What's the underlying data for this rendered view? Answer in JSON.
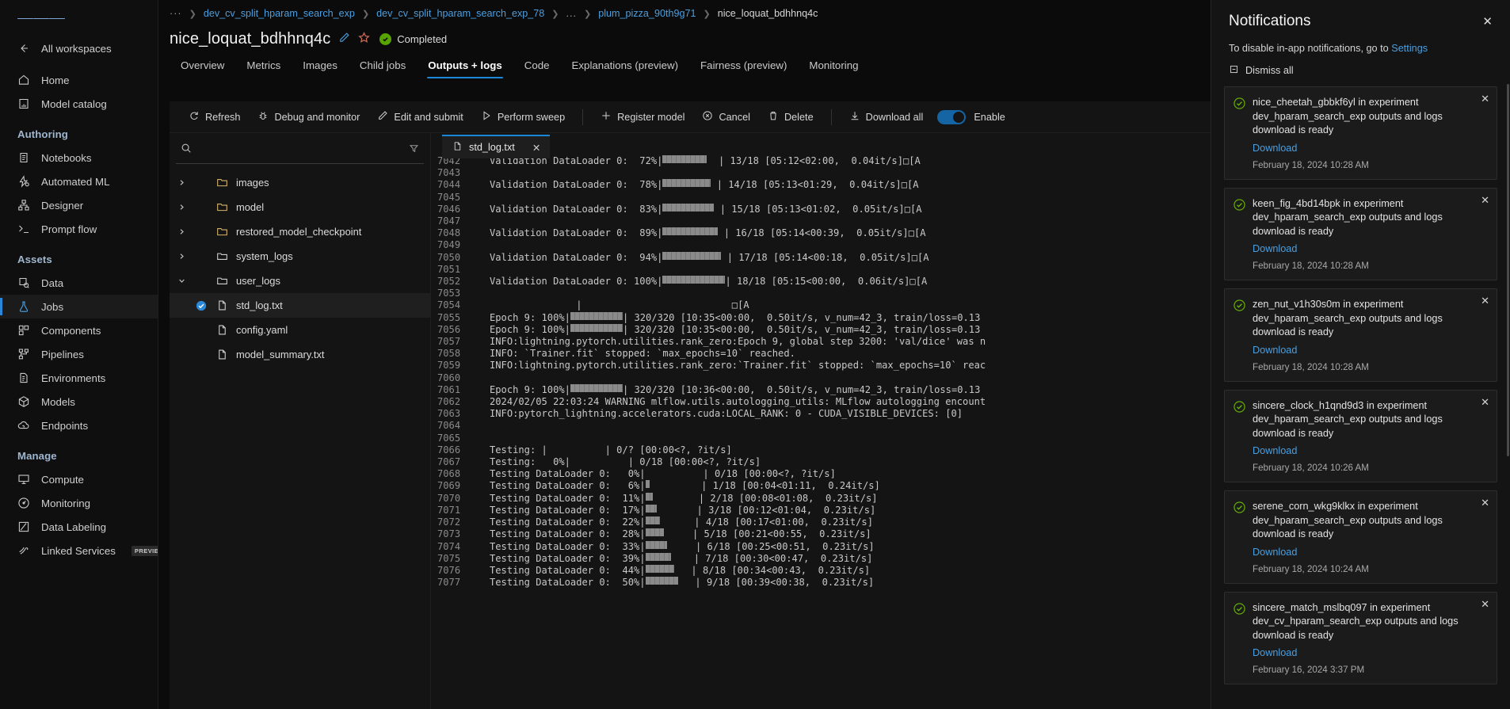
{
  "sidebar": {
    "menu_icon": "hamburger-icon",
    "back_label": "All workspaces",
    "top_items": [
      {
        "label": "Home",
        "icon": "home-icon"
      },
      {
        "label": "Model catalog",
        "icon": "model-catalog-icon"
      }
    ],
    "sections": [
      {
        "title": "Authoring",
        "items": [
          {
            "label": "Notebooks",
            "icon": "notebook-icon"
          },
          {
            "label": "Automated ML",
            "icon": "automated-ml-icon"
          },
          {
            "label": "Designer",
            "icon": "designer-icon"
          },
          {
            "label": "Prompt flow",
            "icon": "terminal-icon"
          }
        ]
      },
      {
        "title": "Assets",
        "items": [
          {
            "label": "Data",
            "icon": "data-icon"
          },
          {
            "label": "Jobs",
            "icon": "flask-icon",
            "active": true
          },
          {
            "label": "Components",
            "icon": "components-icon"
          },
          {
            "label": "Pipelines",
            "icon": "pipelines-icon"
          },
          {
            "label": "Environments",
            "icon": "environments-icon"
          },
          {
            "label": "Models",
            "icon": "cube-icon"
          },
          {
            "label": "Endpoints",
            "icon": "endpoints-icon"
          }
        ]
      },
      {
        "title": "Manage",
        "items": [
          {
            "label": "Compute",
            "icon": "compute-icon"
          },
          {
            "label": "Monitoring",
            "icon": "monitoring-icon"
          },
          {
            "label": "Data Labeling",
            "icon": "data-labeling-icon"
          },
          {
            "label": "Linked Services",
            "icon": "linked-services-icon",
            "badge": "PREVIEW"
          }
        ]
      }
    ]
  },
  "breadcrumb": {
    "overflow": "···",
    "items": [
      {
        "label": "dev_cv_split_hparam_search_exp",
        "link": true
      },
      {
        "label": "dev_cv_split_hparam_search_exp_78",
        "link": true
      },
      {
        "label": "...",
        "link": true,
        "ellipsis": true
      },
      {
        "label": "plum_pizza_90th9g71",
        "link": true
      },
      {
        "label": "nice_loquat_bdhhnq4c",
        "link": false
      }
    ]
  },
  "header": {
    "title": "nice_loquat_bdhhnq4c",
    "edit_icon": "pencil-icon",
    "favorite_icon": "star-icon",
    "status": "Completed",
    "status_color": "#57a300"
  },
  "tabs": [
    {
      "label": "Overview"
    },
    {
      "label": "Metrics"
    },
    {
      "label": "Images"
    },
    {
      "label": "Child jobs"
    },
    {
      "label": "Outputs + logs",
      "active": true
    },
    {
      "label": "Code"
    },
    {
      "label": "Explanations (preview)"
    },
    {
      "label": "Fairness (preview)"
    },
    {
      "label": "Monitoring"
    }
  ],
  "toolbar": {
    "buttons": [
      {
        "label": "Refresh",
        "icon": "refresh-icon"
      },
      {
        "label": "Debug and monitor",
        "icon": "bug-icon"
      },
      {
        "label": "Edit and submit",
        "icon": "pencil-icon"
      },
      {
        "label": "Perform sweep",
        "icon": "play-icon"
      },
      {
        "label": "Register model",
        "icon": "plus-icon"
      },
      {
        "label": "Cancel",
        "icon": "cancel-icon"
      },
      {
        "label": "Delete",
        "icon": "trash-icon"
      }
    ],
    "download_all": {
      "label": "Download all",
      "icon": "download-icon"
    },
    "toggle_label": "Enable",
    "toggle_on": true,
    "toggle_color": "#1565a5"
  },
  "filetree": {
    "search_placeholder": "",
    "search_value": "",
    "search_icon": "search-icon",
    "filter_icon": "filter-icon",
    "nodes": [
      {
        "label": "images",
        "type": "folder",
        "expandable": true,
        "expanded": false,
        "indent": 0
      },
      {
        "label": "model",
        "type": "folder",
        "expandable": true,
        "expanded": false,
        "indent": 0
      },
      {
        "label": "restored_model_checkpoint",
        "type": "folder",
        "expandable": true,
        "expanded": false,
        "indent": 0
      },
      {
        "label": "system_logs",
        "type": "folder-open",
        "expandable": true,
        "expanded": false,
        "indent": 0
      },
      {
        "label": "user_logs",
        "type": "folder-open",
        "expandable": true,
        "expanded": true,
        "indent": 0
      },
      {
        "label": "std_log.txt",
        "type": "file",
        "expandable": false,
        "indent": 1,
        "selected": true,
        "checked": true
      },
      {
        "label": "config.yaml",
        "type": "file",
        "expandable": false,
        "indent": 0
      },
      {
        "label": "model_summary.txt",
        "type": "file",
        "expandable": false,
        "indent": 0
      }
    ]
  },
  "filetab": {
    "label": "std_log.txt",
    "file_icon": "file-icon",
    "close_icon": "close-icon"
  },
  "log": {
    "lines": [
      {
        "n": "7042",
        "t": "Validation DataLoader 0:  72%|",
        "bar": 56,
        "t2": "  | 13/18 [05:12<02:00,  0.04it/s]□[A"
      },
      {
        "n": "7043",
        "t": ""
      },
      {
        "n": "7044",
        "t": "Validation DataLoader 0:  78%|",
        "bar": 61,
        "t2": " | 14/18 [05:13<01:29,  0.04it/s]□[A"
      },
      {
        "n": "7045",
        "t": ""
      },
      {
        "n": "7046",
        "t": "Validation DataLoader 0:  83%|",
        "bar": 65,
        "t2": " | 15/18 [05:13<01:02,  0.05it/s]□[A"
      },
      {
        "n": "7047",
        "t": ""
      },
      {
        "n": "7048",
        "t": "Validation DataLoader 0:  89%|",
        "bar": 70,
        "t2": " | 16/18 [05:14<00:39,  0.05it/s]□[A"
      },
      {
        "n": "7049",
        "t": ""
      },
      {
        "n": "7050",
        "t": "Validation DataLoader 0:  94%|",
        "bar": 74,
        "t2": " | 17/18 [05:14<00:18,  0.05it/s]□[A"
      },
      {
        "n": "7051",
        "t": ""
      },
      {
        "n": "7052",
        "t": "Validation DataLoader 0: 100%|",
        "bar": 79,
        "t2": "| 18/18 [05:15<00:00,  0.06it/s]□[A"
      },
      {
        "n": "7053",
        "t": ""
      },
      {
        "n": "7054",
        "t": "               |                          □[A"
      },
      {
        "n": "7055",
        "t": "Epoch 9: 100%|",
        "bar": 66,
        "t2": "| 320/320 [10:35<00:00,  0.50it/s, v_num=42_3, train/loss=0.13"
      },
      {
        "n": "7056",
        "t": "Epoch 9: 100%|",
        "bar": 66,
        "t2": "| 320/320 [10:35<00:00,  0.50it/s, v_num=42_3, train/loss=0.13"
      },
      {
        "n": "7057",
        "t": "INFO:lightning.pytorch.utilities.rank_zero:Epoch 9, global step 3200: 'val/dice' was n"
      },
      {
        "n": "7058",
        "t": "INFO: `Trainer.fit` stopped: `max_epochs=10` reached."
      },
      {
        "n": "7059",
        "t": "INFO:lightning.pytorch.utilities.rank_zero:`Trainer.fit` stopped: `max_epochs=10` reac"
      },
      {
        "n": "7060",
        "t": ""
      },
      {
        "n": "7061",
        "t": "Epoch 9: 100%|",
        "bar": 66,
        "t2": "| 320/320 [10:36<00:00,  0.50it/s, v_num=42_3, train/loss=0.13"
      },
      {
        "n": "7062",
        "t": "2024/02/05 22:03:24 WARNING mlflow.utils.autologging_utils: MLflow autologging encount"
      },
      {
        "n": "7063",
        "t": "INFO:pytorch_lightning.accelerators.cuda:LOCAL_RANK: 0 - CUDA_VISIBLE_DEVICES: [0]"
      },
      {
        "n": "7064",
        "t": ""
      },
      {
        "n": "7065",
        "t": ""
      },
      {
        "n": "7066",
        "t": "Testing: |          | 0/? [00:00<?, ?it/s]"
      },
      {
        "n": "7067",
        "t": "Testing:   0%|          | 0/18 [00:00<?, ?it/s]"
      },
      {
        "n": "7068",
        "t": "Testing DataLoader 0:   0%|",
        "bar": 0,
        "t2": "          | 0/18 [00:00<?, ?it/s]"
      },
      {
        "n": "7069",
        "t": "Testing DataLoader 0:   6%|",
        "bar": 5,
        "t2": "         | 1/18 [00:04<01:11,  0.24it/s]"
      },
      {
        "n": "7070",
        "t": "Testing DataLoader 0:  11%|",
        "bar": 9,
        "t2": "        | 2/18 [00:08<01:08,  0.23it/s]"
      },
      {
        "n": "7071",
        "t": "Testing DataLoader 0:  17%|",
        "bar": 14,
        "t2": "       | 3/18 [00:12<01:04,  0.23it/s]"
      },
      {
        "n": "7072",
        "t": "Testing DataLoader 0:  22%|",
        "bar": 18,
        "t2": "      | 4/18 [00:17<01:00,  0.23it/s]"
      },
      {
        "n": "7073",
        "t": "Testing DataLoader 0:  28%|",
        "bar": 23,
        "t2": "     | 5/18 [00:21<00:55,  0.23it/s]"
      },
      {
        "n": "7074",
        "t": "Testing DataLoader 0:  33%|",
        "bar": 27,
        "t2": "     | 6/18 [00:25<00:51,  0.23it/s]"
      },
      {
        "n": "7075",
        "t": "Testing DataLoader 0:  39%|",
        "bar": 32,
        "t2": "    | 7/18 [00:30<00:47,  0.23it/s]"
      },
      {
        "n": "7076",
        "t": "Testing DataLoader 0:  44%|",
        "bar": 36,
        "t2": "   | 8/18 [00:34<00:43,  0.23it/s]"
      },
      {
        "n": "7077",
        "t": "Testing DataLoader 0:  50%|",
        "bar": 41,
        "t2": "   | 9/18 [00:39<00:38,  0.23it/s]"
      }
    ]
  },
  "notifications": {
    "title": "Notifications",
    "close_icon": "close-icon",
    "subtitle_prefix": "To disable in-app notifications, go to ",
    "settings_link": "Settings",
    "dismiss_all": "Dismiss all",
    "dismiss_icon": "dismiss-icon",
    "items": [
      {
        "message": "nice_cheetah_gbbkf6yl in experiment dev_hparam_search_exp outputs and logs download is ready",
        "link": "Download",
        "time": "February 18, 2024 10:28 AM",
        "status_icon": "success-check-icon"
      },
      {
        "message": "keen_fig_4bd14bpk in experiment dev_hparam_search_exp outputs and logs download is ready",
        "link": "Download",
        "time": "February 18, 2024 10:28 AM",
        "status_icon": "success-check-icon"
      },
      {
        "message": "zen_nut_v1h30s0m in experiment dev_hparam_search_exp outputs and logs download is ready",
        "link": "Download",
        "time": "February 18, 2024 10:28 AM",
        "status_icon": "success-check-icon"
      },
      {
        "message": "sincere_clock_h1qnd9d3 in experiment dev_hparam_search_exp outputs and logs download is ready",
        "link": "Download",
        "time": "February 18, 2024 10:26 AM",
        "status_icon": "success-check-icon"
      },
      {
        "message": "serene_corn_wkg9klkx in experiment dev_hparam_search_exp outputs and logs download is ready",
        "link": "Download",
        "time": "February 18, 2024 10:24 AM",
        "status_icon": "success-check-icon"
      },
      {
        "message": "sincere_match_mslbq097 in experiment dev_cv_hparam_search_exp outputs and logs download is ready",
        "link": "Download",
        "time": "February 16, 2024 3:37 PM",
        "status_icon": "success-check-icon"
      }
    ]
  }
}
